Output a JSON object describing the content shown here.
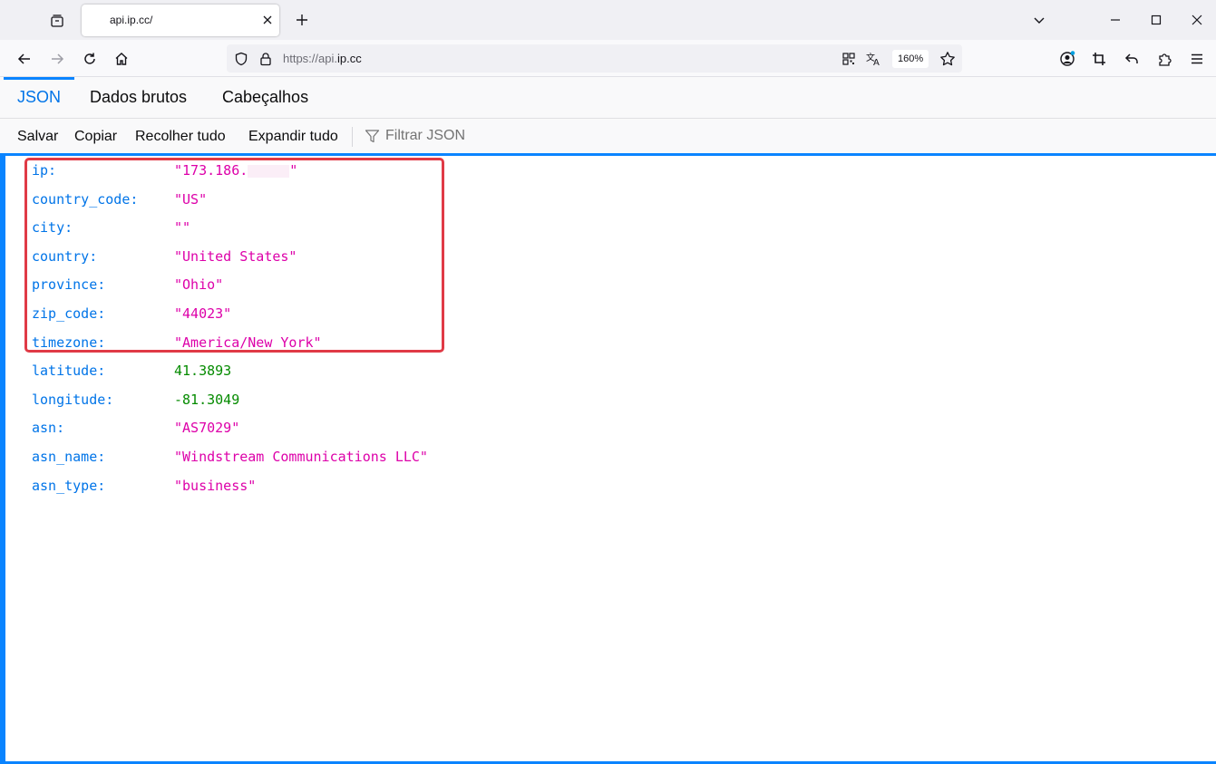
{
  "tab": {
    "title": "api.ip.cc/"
  },
  "url": {
    "prefix": "https://api.",
    "host": "ip.cc",
    "zoom": "160%"
  },
  "viewer_tabs": [
    "JSON",
    "Dados brutos",
    "Cabeçalhos"
  ],
  "toolbar": {
    "save": "Salvar",
    "copy": "Copiar",
    "collapse": "Recolher tudo",
    "expand": "Expandir tudo",
    "filter_placeholder": "Filtrar JSON"
  },
  "json": [
    {
      "key": "ip:",
      "value": "\"173.186.",
      "value_suffix": "\"",
      "type": "string"
    },
    {
      "key": "country_code:",
      "value": "\"US\"",
      "type": "string"
    },
    {
      "key": "city:",
      "value": "\"\"",
      "type": "string"
    },
    {
      "key": "country:",
      "value": "\"United States\"",
      "type": "string"
    },
    {
      "key": "province:",
      "value": "\"Ohio\"",
      "type": "string"
    },
    {
      "key": "zip_code:",
      "value": "\"44023\"",
      "type": "string"
    },
    {
      "key": "timezone:",
      "value": "\"America/New_York\"",
      "type": "string"
    },
    {
      "key": "latitude:",
      "value": "41.3893",
      "type": "number"
    },
    {
      "key": "longitude:",
      "value": "-81.3049",
      "type": "number"
    },
    {
      "key": "asn:",
      "value": "\"AS7029\"",
      "type": "string"
    },
    {
      "key": "asn_name:",
      "value": "\"Windstream Communications LLC\"",
      "type": "string"
    },
    {
      "key": "asn_type:",
      "value": "\"business\"",
      "type": "string"
    }
  ],
  "colors": {
    "accent": "#0a84ff",
    "key": "#0074e8",
    "string": "#dd00a9",
    "number": "#058b00",
    "highlight": "#e03a46"
  }
}
